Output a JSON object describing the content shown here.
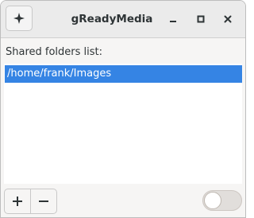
{
  "window": {
    "title": "gReadyMedia"
  },
  "titlebar": {
    "app_menu_icon": "sparkle-icon",
    "minimize_icon": "minimize-icon",
    "maximize_icon": "maximize-icon",
    "close_icon": "close-icon"
  },
  "shared_folders": {
    "label": "Shared folders list:",
    "items": [
      {
        "path": "/home/frank/Images",
        "selected": true
      }
    ]
  },
  "toolbar": {
    "add_icon": "plus-icon",
    "remove_icon": "minus-icon",
    "sharing_switch": {
      "state": "off"
    }
  },
  "colors": {
    "selection": "#3584e4",
    "titlebar": "#ebebeb",
    "window_bg": "#f6f5f4"
  }
}
